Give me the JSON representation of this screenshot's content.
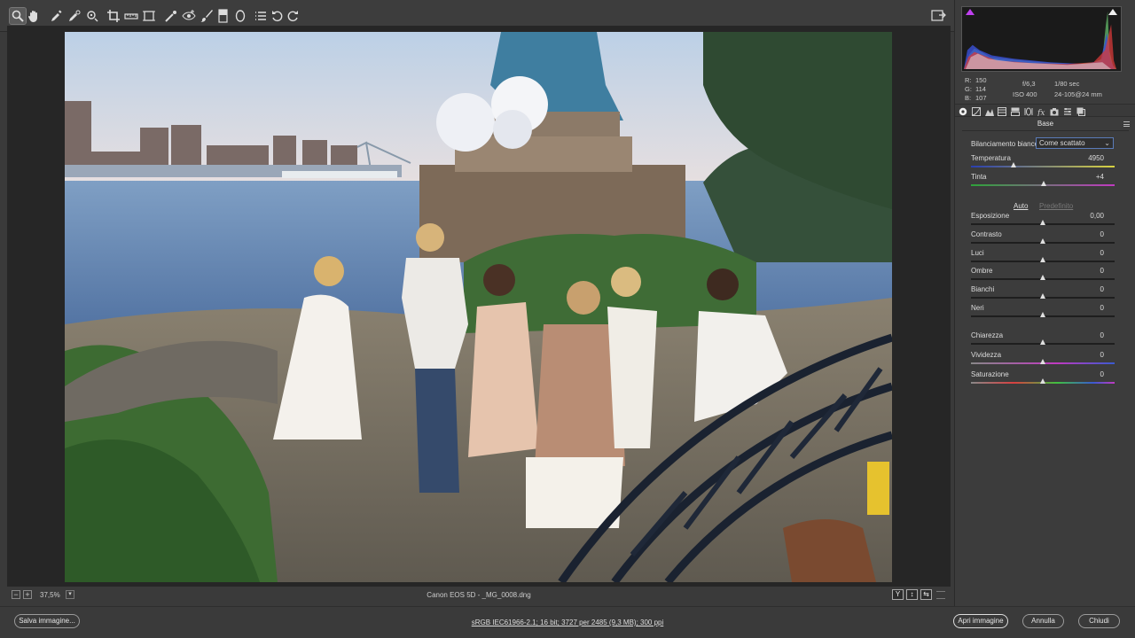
{
  "toolbar": {
    "tools": [
      {
        "name": "zoom-tool",
        "icon": "magnifier-icon",
        "active": true
      },
      {
        "name": "hand-tool",
        "icon": "hand-icon"
      },
      {
        "name": "white-balance-tool",
        "icon": "eyedropper-icon"
      },
      {
        "name": "color-sampler-tool",
        "icon": "color-sampler-icon"
      },
      {
        "name": "targeted-adjustment-tool",
        "icon": "target-adjust-icon"
      },
      {
        "name": "crop-tool",
        "icon": "crop-icon"
      },
      {
        "name": "straighten-tool",
        "icon": "straighten-icon"
      },
      {
        "name": "transform-tool",
        "icon": "transform-icon"
      },
      {
        "name": "spot-removal-tool",
        "icon": "spot-removal-icon"
      },
      {
        "name": "red-eye-tool",
        "icon": "red-eye-icon"
      },
      {
        "name": "adjustment-brush-tool",
        "icon": "brush-icon"
      },
      {
        "name": "graduated-filter-tool",
        "icon": "graduated-filter-icon"
      },
      {
        "name": "radial-filter-tool",
        "icon": "radial-filter-icon"
      },
      {
        "name": "preferences-tool",
        "icon": "list-icon"
      },
      {
        "name": "rotate-left-tool",
        "icon": "rotate-ccw-icon"
      },
      {
        "name": "rotate-right-tool",
        "icon": "rotate-cw-icon"
      }
    ]
  },
  "status": {
    "zoom": "37,5%",
    "filename": "Canon EOS 5D  -  _MG_0008.dng",
    "view_buttons": [
      "Y",
      "↕",
      "⇆"
    ]
  },
  "histogram": {
    "rgb": {
      "r": "150",
      "g": "114",
      "b": "107"
    },
    "labels": {
      "r": "R:",
      "g": "G:",
      "b": "B:"
    },
    "aperture": "f/6,3",
    "shutter": "1/80 sec",
    "iso": "ISO 400",
    "lens": "24-105@24 mm"
  },
  "panel": {
    "title": "Base",
    "tabs": [
      "basic-icon",
      "tone-curve-icon",
      "detail-icon",
      "hsl-icon",
      "split-toning-icon",
      "lens-icon",
      "effects-icon",
      "fx-icon",
      "camera-calibration-icon",
      "presets-icon",
      "snapshots-icon"
    ],
    "wb_label": "Bilanciamento bianco:",
    "wb_value": "Come scattato",
    "auto": "Auto",
    "default": "Predefinito",
    "sliders": [
      {
        "key": "temperatura",
        "label": "Temperatura",
        "value": "4950",
        "pos": 0.3,
        "track": "temp"
      },
      {
        "key": "tinta",
        "label": "Tinta",
        "value": "+4",
        "pos": 0.51,
        "track": "tint"
      },
      {
        "key": "esposizione",
        "label": "Esposizione",
        "value": "0,00",
        "pos": 0.5,
        "track": "neutral"
      },
      {
        "key": "contrasto",
        "label": "Contrasto",
        "value": "0",
        "pos": 0.5,
        "track": "neutral"
      },
      {
        "key": "luci",
        "label": "Luci",
        "value": "0",
        "pos": 0.5,
        "track": "neutral"
      },
      {
        "key": "ombre",
        "label": "Ombre",
        "value": "0",
        "pos": 0.5,
        "track": "neutral"
      },
      {
        "key": "bianchi",
        "label": "Bianchi",
        "value": "0",
        "pos": 0.5,
        "track": "neutral"
      },
      {
        "key": "neri",
        "label": "Neri",
        "value": "0",
        "pos": 0.5,
        "track": "neutral"
      },
      {
        "key": "chiarezza",
        "label": "Chiarezza",
        "value": "0",
        "pos": 0.5,
        "track": "neutral"
      },
      {
        "key": "vividezza",
        "label": "Vividezza",
        "value": "0",
        "pos": 0.5,
        "track": "vivid"
      },
      {
        "key": "saturazione",
        "label": "Saturazione",
        "value": "0",
        "pos": 0.5,
        "track": "sat"
      }
    ]
  },
  "footer": {
    "save": "Salva immagine...",
    "workflow": "sRGB IEC61966-2.1; 16 bit; 3727 per 2485 (9,3 MB); 300 ppi",
    "open": "Apri immagine",
    "cancel": "Annulla",
    "done": "Chiudi"
  }
}
